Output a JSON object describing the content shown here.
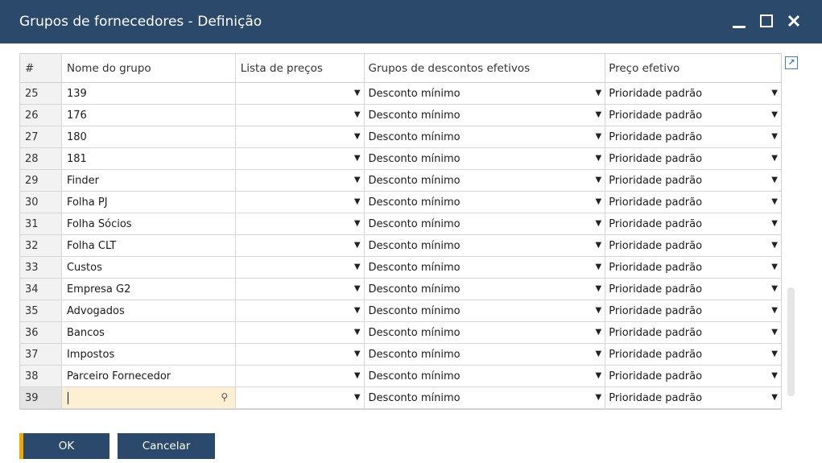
{
  "window": {
    "title": "Grupos de fornecedores - Definição",
    "minimize_label": "_",
    "close_label": "✕"
  },
  "grid": {
    "columns": [
      "#",
      "Nome do grupo",
      "Lista de preços",
      "Grupos de descontos efetivos",
      "Preço efetivo"
    ],
    "rows": [
      {
        "num": "25",
        "name": "139",
        "price_list": "",
        "discount": "Desconto mínimo",
        "price": "Prioridade padrão"
      },
      {
        "num": "26",
        "name": "176",
        "price_list": "",
        "discount": "Desconto mínimo",
        "price": "Prioridade padrão"
      },
      {
        "num": "27",
        "name": "180",
        "price_list": "",
        "discount": "Desconto mínimo",
        "price": "Prioridade padrão"
      },
      {
        "num": "28",
        "name": "181",
        "price_list": "",
        "discount": "Desconto mínimo",
        "price": "Prioridade padrão"
      },
      {
        "num": "29",
        "name": "Finder",
        "price_list": "",
        "discount": "Desconto mínimo",
        "price": "Prioridade padrão"
      },
      {
        "num": "30",
        "name": "Folha PJ",
        "price_list": "",
        "discount": "Desconto mínimo",
        "price": "Prioridade padrão"
      },
      {
        "num": "31",
        "name": "Folha Sócios",
        "price_list": "",
        "discount": "Desconto mínimo",
        "price": "Prioridade padrão"
      },
      {
        "num": "32",
        "name": "Folha CLT",
        "price_list": "",
        "discount": "Desconto mínimo",
        "price": "Prioridade padrão"
      },
      {
        "num": "33",
        "name": "Custos",
        "price_list": "",
        "discount": "Desconto mínimo",
        "price": "Prioridade padrão"
      },
      {
        "num": "34",
        "name": "Empresa G2",
        "price_list": "",
        "discount": "Desconto mínimo",
        "price": "Prioridade padrão"
      },
      {
        "num": "35",
        "name": "Advogados",
        "price_list": "",
        "discount": "Desconto mínimo",
        "price": "Prioridade padrão"
      },
      {
        "num": "36",
        "name": "Bancos",
        "price_list": "",
        "discount": "Desconto mínimo",
        "price": "Prioridade padrão"
      },
      {
        "num": "37",
        "name": "Impostos",
        "price_list": "",
        "discount": "Desconto mínimo",
        "price": "Prioridade padrão"
      },
      {
        "num": "38",
        "name": "Parceiro Fornecedor",
        "price_list": "",
        "discount": "Desconto mínimo",
        "price": "Prioridade padrão"
      },
      {
        "num": "39",
        "name": "",
        "price_list": "",
        "discount": "Desconto mínimo",
        "price": "Prioridade padrão",
        "active": true
      }
    ]
  },
  "buttons": {
    "ok": "OK",
    "cancel": "Cancelar"
  },
  "icons": {
    "dropdown": "triangle-down-icon",
    "lookup": "lookup-icon",
    "expand": "arrow-up-right-icon"
  },
  "colors": {
    "titlebar": "#2b4a6b",
    "ok_accent": "#f0a800",
    "active_cell": "#fdf0d2"
  }
}
